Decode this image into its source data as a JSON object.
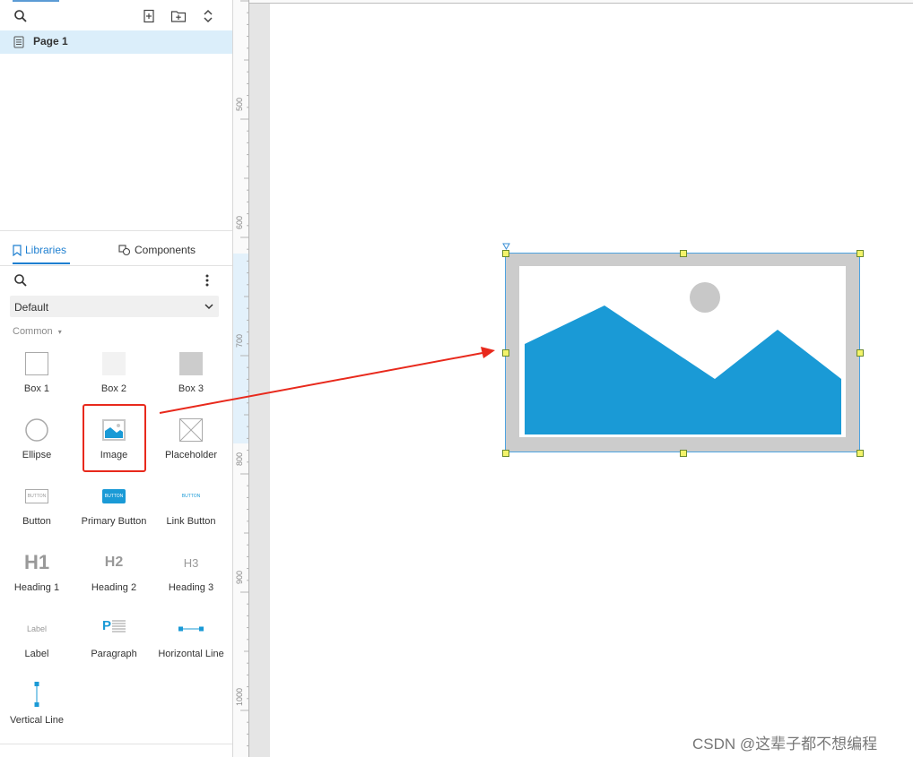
{
  "pages": {
    "items": [
      {
        "label": "Page 1"
      }
    ]
  },
  "tabs": {
    "libraries": "Libraries",
    "components": "Components"
  },
  "library": {
    "selected": "Default",
    "section": "Common",
    "items": [
      {
        "label": "Box 1",
        "icon": "box-1-icon"
      },
      {
        "label": "Box 2",
        "icon": "box-2-icon"
      },
      {
        "label": "Box 3",
        "icon": "box-3-icon"
      },
      {
        "label": "Ellipse",
        "icon": "ellipse-icon"
      },
      {
        "label": "Image",
        "icon": "image-icon"
      },
      {
        "label": "Placeholder",
        "icon": "placeholder-icon"
      },
      {
        "label": "Button",
        "icon": "button-icon",
        "glyph": "BUTTON"
      },
      {
        "label": "Primary Button",
        "icon": "primary-button-icon",
        "glyph": "BUTTON"
      },
      {
        "label": "Link Button",
        "icon": "link-button-icon",
        "glyph": "BUTTON"
      },
      {
        "label": "Heading 1",
        "icon": "heading-1-icon",
        "glyph": "H1"
      },
      {
        "label": "Heading 2",
        "icon": "heading-2-icon",
        "glyph": "H2"
      },
      {
        "label": "Heading 3",
        "icon": "heading-3-icon",
        "glyph": "H3"
      },
      {
        "label": "Label",
        "icon": "label-icon",
        "glyph": "Label"
      },
      {
        "label": "Paragraph",
        "icon": "paragraph-icon",
        "glyph": "P"
      },
      {
        "label": "Horizontal Line",
        "icon": "horizontal-line-icon"
      },
      {
        "label": "Vertical Line",
        "icon": "vertical-line-icon"
      }
    ]
  },
  "ruler": {
    "marks": [
      "500",
      "600",
      "700",
      "800",
      "900",
      "1000"
    ]
  },
  "watermark": "CSDN @这辈子都不想编程",
  "colors": {
    "accent": "#1e7fd0",
    "image_blue": "#1a9ad6",
    "highlight": "#dbeefa",
    "annotation": "#e8291c"
  }
}
